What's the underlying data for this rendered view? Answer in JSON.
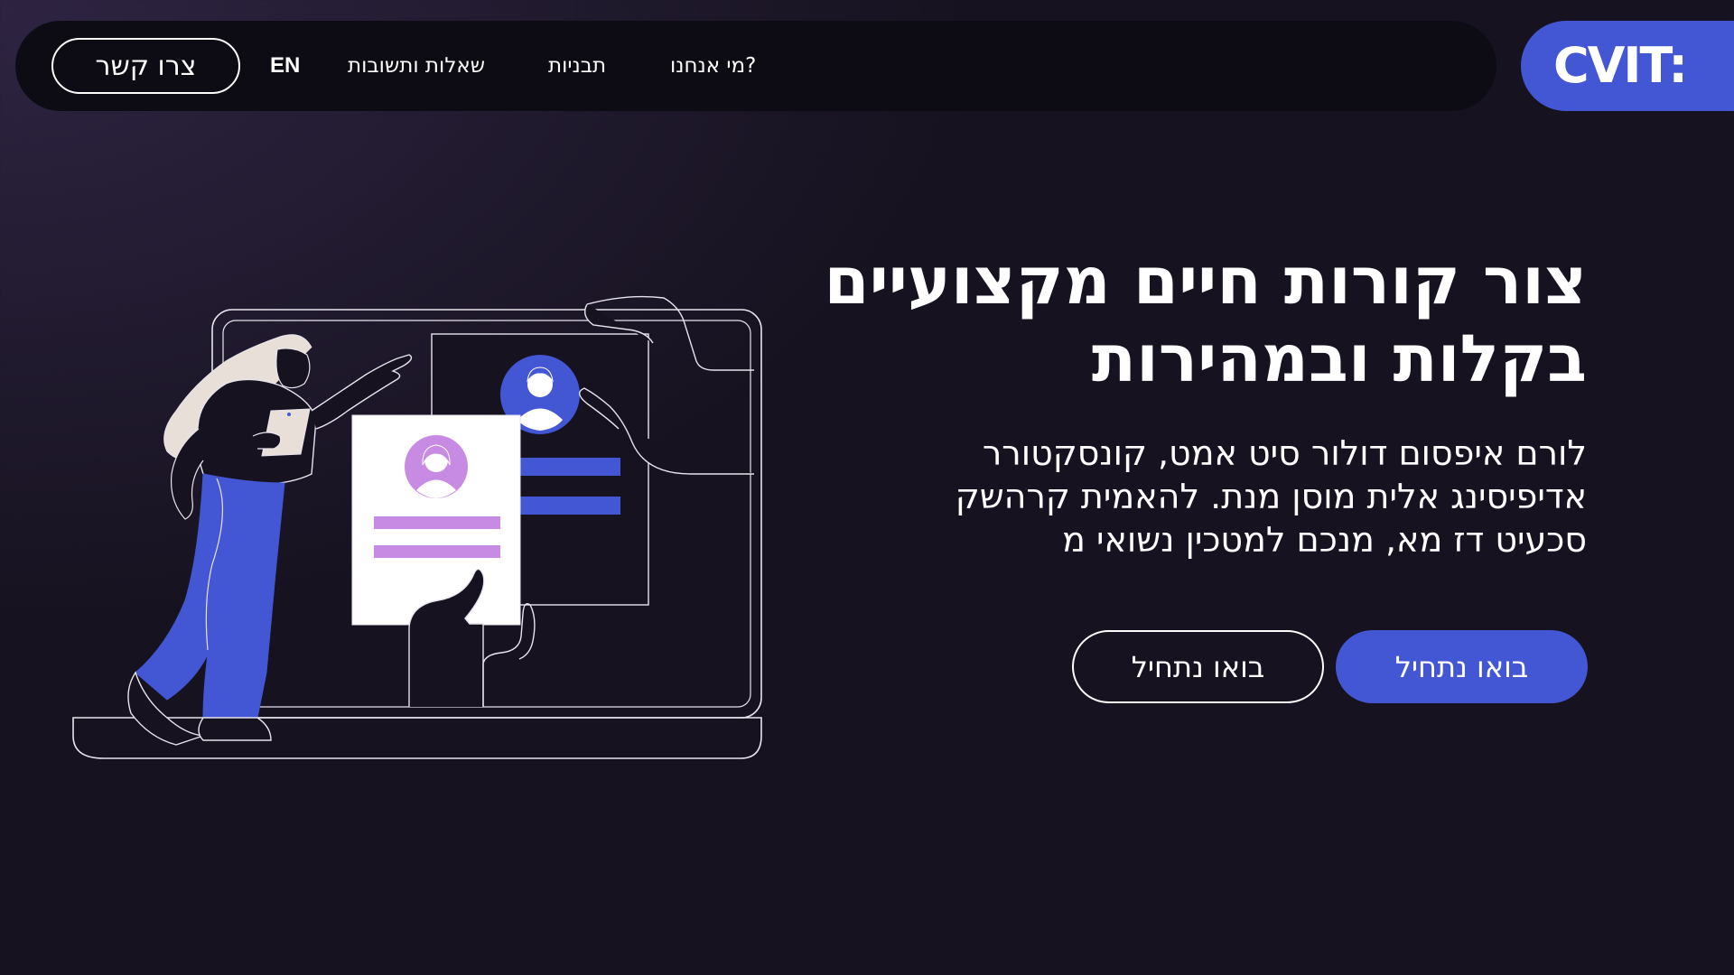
{
  "nav": {
    "contact_label": "צרו קשר",
    "lang_label": "EN",
    "faq_label": "שאלות ותשובות",
    "templates_label": "תבניות",
    "about_label": "מי אנחנו?"
  },
  "logo": {
    "text": "CVIT:"
  },
  "hero": {
    "title": "צור קורות חיים מקצועיים בקלות ובמהירות",
    "body": "לורם איפסום דולור סיט אמט, קונסקטורר אדיפיסינג אלית מוסן מנת. להאמית קרהשק סכעיט דז מא, מנכם למטכין נשואי מ",
    "primary_button": "בואו נתחיל",
    "secondary_button": "בואו נתחיל"
  },
  "icons": {
    "illustration": "person-building-resume-illustration"
  },
  "colors": {
    "accent": "#4356d3",
    "accent_light": "#c88be4",
    "background": "#16121f",
    "navbar": "#0d0c14",
    "text": "#ffffff"
  }
}
